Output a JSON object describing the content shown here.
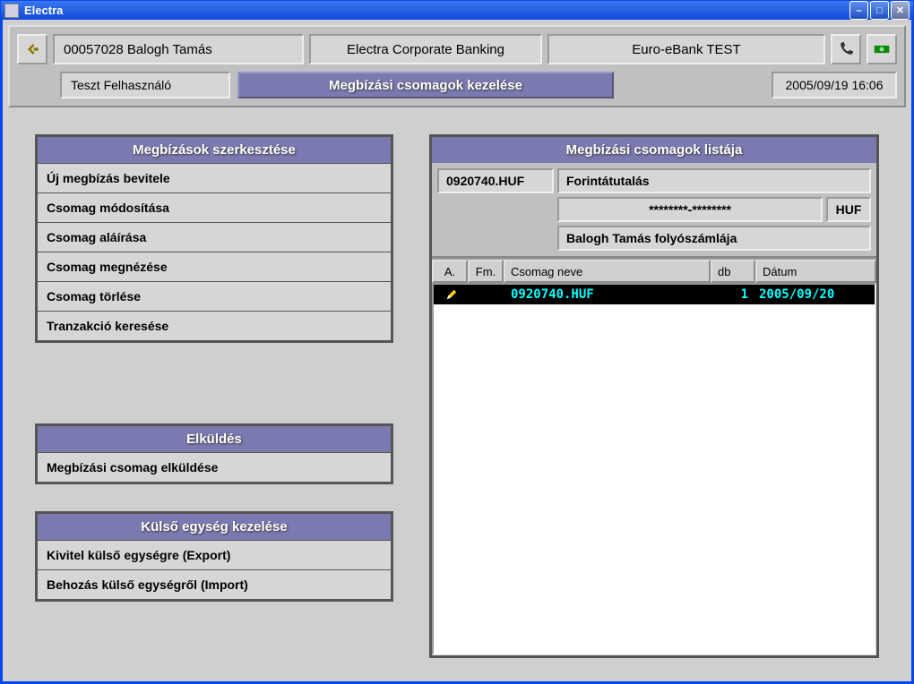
{
  "window": {
    "title": "Electra"
  },
  "header": {
    "account": "00057028 Balogh Tamás",
    "app_name": "Electra Corporate Banking",
    "bank_name": "Euro-eBank TEST",
    "user": "Teszt Felhasználó",
    "page_title": "Megbízási csomagok kezelése",
    "datetime": "2005/09/19 16:06"
  },
  "panels": {
    "edit": {
      "title": "Megbízások szerkesztése",
      "items": [
        "Új megbízás bevitele",
        "Csomag módosítása",
        "Csomag aláírása",
        "Csomag megnézése",
        "Csomag törlése",
        "Tranzakció keresése"
      ]
    },
    "send": {
      "title": "Elküldés",
      "items": [
        "Megbízási csomag elküldése"
      ]
    },
    "external": {
      "title": "Külső egység kezelése",
      "items": [
        "Kivitel külső egységre (Export)",
        "Behozás külső egységről (Import)"
      ]
    }
  },
  "list": {
    "title": "Megbízási csomagok listája",
    "detail": {
      "package_id": "0920740.HUF",
      "type": "Forintátutalás",
      "account_num": "********-********",
      "currency": "HUF",
      "account_name": "Balogh Tamás folyószámlája"
    },
    "columns": {
      "a": "A.",
      "fm": "Fm.",
      "name": "Csomag neve",
      "db": "db",
      "date": "Dátum"
    },
    "rows": [
      {
        "name": "0920740.HUF",
        "db": "1",
        "date": "2005/09/20"
      }
    ]
  }
}
